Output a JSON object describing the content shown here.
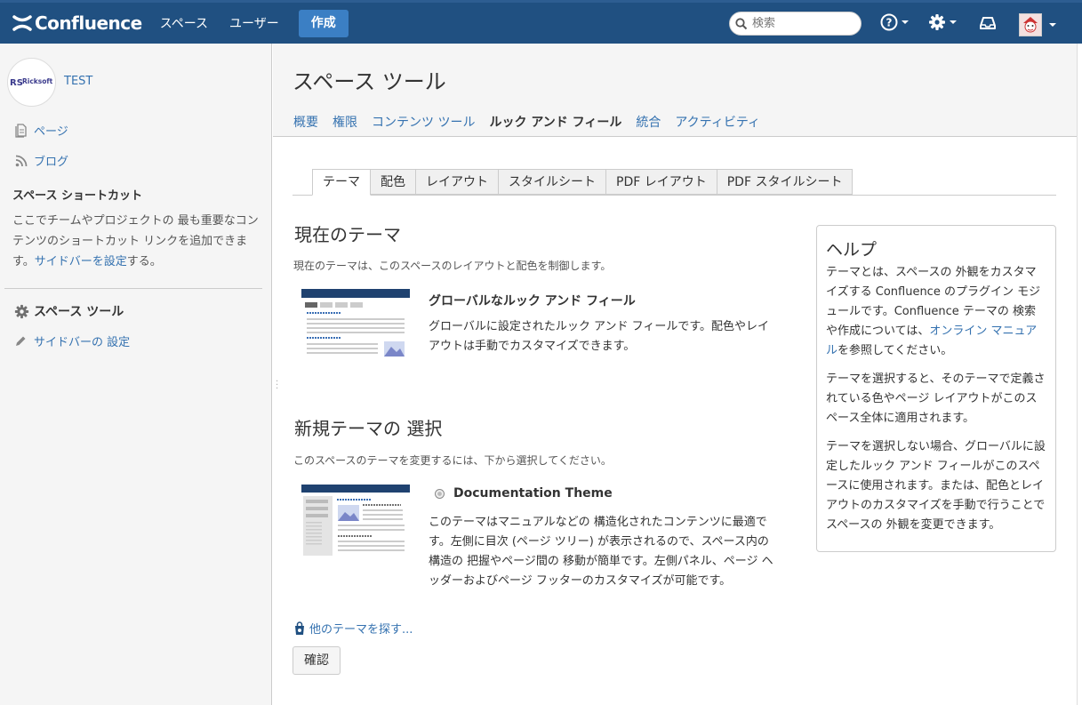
{
  "header": {
    "brand": "Confluence",
    "nav": [
      "スペース",
      "ユーザー"
    ],
    "create_label": "作成",
    "search_placeholder": "検索",
    "icons": [
      "help-icon",
      "settings-icon",
      "notifications-icon",
      "user-avatar"
    ]
  },
  "sidebar": {
    "space_logo_text": "Ricksoft",
    "space_name": "TEST",
    "items": [
      {
        "label": "ページ",
        "icon": "page-icon"
      },
      {
        "label": "ブログ",
        "icon": "rss-icon"
      }
    ],
    "shortcut_title": "スペース ショートカット",
    "shortcut_text_before": "ここでチームやプロジェクトの 最も重要なコンテンツのショートカット リンクを追加できます。",
    "shortcut_link": "サイドバーを設定",
    "shortcut_text_after": "する。",
    "space_tools_label": "スペース ツール",
    "sidebar_settings_label": "サイドバーの 設定"
  },
  "main": {
    "title": "スペース ツール",
    "tabs": [
      {
        "label": "概要",
        "active": false
      },
      {
        "label": "権限",
        "active": false
      },
      {
        "label": "コンテンツ ツール",
        "active": false
      },
      {
        "label": "ルック アンド フィール",
        "active": true
      },
      {
        "label": "統合",
        "active": false
      },
      {
        "label": "アクティビティ",
        "active": false
      }
    ],
    "subtabs": [
      "テーマ",
      "配色",
      "レイアウト",
      "スタイルシート",
      "PDF レイアウト",
      "PDF スタイルシート"
    ],
    "current_theme": {
      "heading": "現在のテーマ",
      "subtext": "現在のテーマは、このスペースのレイアウトと配色を制御します。",
      "name": "グローバルなルック アンド フィール",
      "desc": "グローバルに設定されたルック アンド フィールです。配色やレイアウトは手動でカスタマイズできます。"
    },
    "new_theme": {
      "heading": "新規テーマの 選択",
      "subtext": "このスペースのテーマを変更するには、下から選択してください。",
      "name": "Documentation Theme",
      "desc": "このテーマはマニュアルなどの 構造化されたコンテンツに最適です。左側に目次 (ページ ツリー) が表示されるので、スペース内の 構造の 把握やページ間の 移動が簡単です。左側パネル、ページ ヘッダーおよびページ フッターのカスタマイズが可能です。"
    },
    "more_themes_label": "他のテーマを探す...",
    "confirm_label": "確認"
  },
  "help": {
    "title": "ヘルプ",
    "p1_before": "テーマとは、スペースの 外観をカスタマイズする Confluence のプラグイン モジュールです。Confluence テーマの 検索や作成については、",
    "p1_link": "オンライン マニュアル",
    "p1_after": "を参照してください。",
    "p2": "テーマを選択すると、そのテーマで定義されている色やページ レイアウトがこのスペース全体に適用されます。",
    "p3": "テーマを選択しない場合、グローバルに設定したルック アンド フィールがこのスペースに使用されます。または、配色とレイアウトのカスタマイズを手動で行うことでスペースの 外観を変更できます。"
  },
  "colors": {
    "header_bg": "#205081",
    "link": "#3572b0",
    "sidebar_bg": "#f5f5f5"
  }
}
